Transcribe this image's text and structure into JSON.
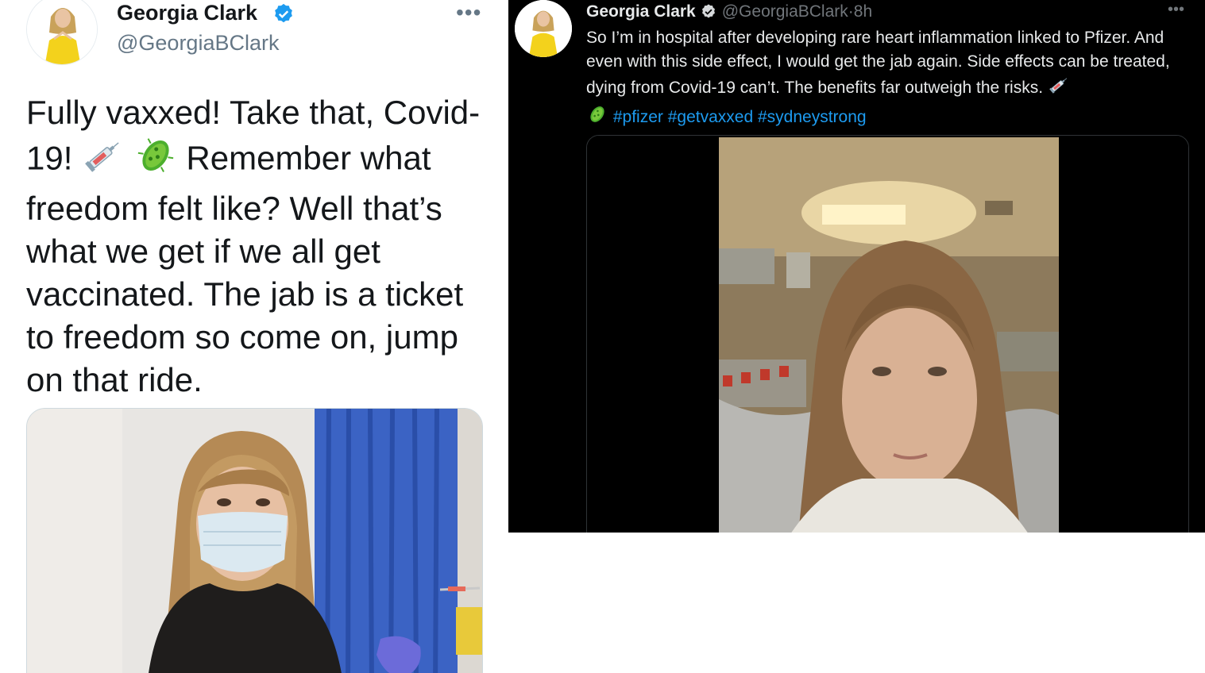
{
  "light_tweet": {
    "author_name": "Georgia Clark",
    "handle": "@GeorgiaBClark",
    "more_label": "•••",
    "text_part1": "Fully vaxxed! Take that, Covid-19! ",
    "text_part2": " Remember what freedom felt like? Well that’s what we get if we all get vaccinated. The jab is a ticket to freedom so come on, jump on that ride.",
    "icons": [
      "verified-badge-icon",
      "syringe-icon",
      "microbe-icon",
      "more-icon"
    ],
    "colors": {
      "background": "#ffffff",
      "text": "#14171a",
      "secondary": "#657786",
      "verified": "#1d9bf0"
    }
  },
  "dark_tweet": {
    "author_name": "Georgia Clark",
    "handle": "@GeorgiaBClark",
    "separator": " · ",
    "time": "8h",
    "more_label": "•••",
    "text_main": "So I’m in hospital after developing rare heart inflammation linked to Pfizer. And even with this side effect, I would get the jab again. Side effects can be treated, dying from Covid-19 can’t. The benefits far outweigh the risks. ",
    "hashtags": [
      "#pfizer",
      "#getvaxxed",
      "#sydneystrong"
    ],
    "icons": [
      "verified-badge-icon",
      "syringe-icon",
      "microbe-icon",
      "more-icon"
    ],
    "colors": {
      "background": "#000000",
      "text": "#e7e9ea",
      "secondary": "#71767b",
      "link": "#1d9bf0"
    }
  }
}
